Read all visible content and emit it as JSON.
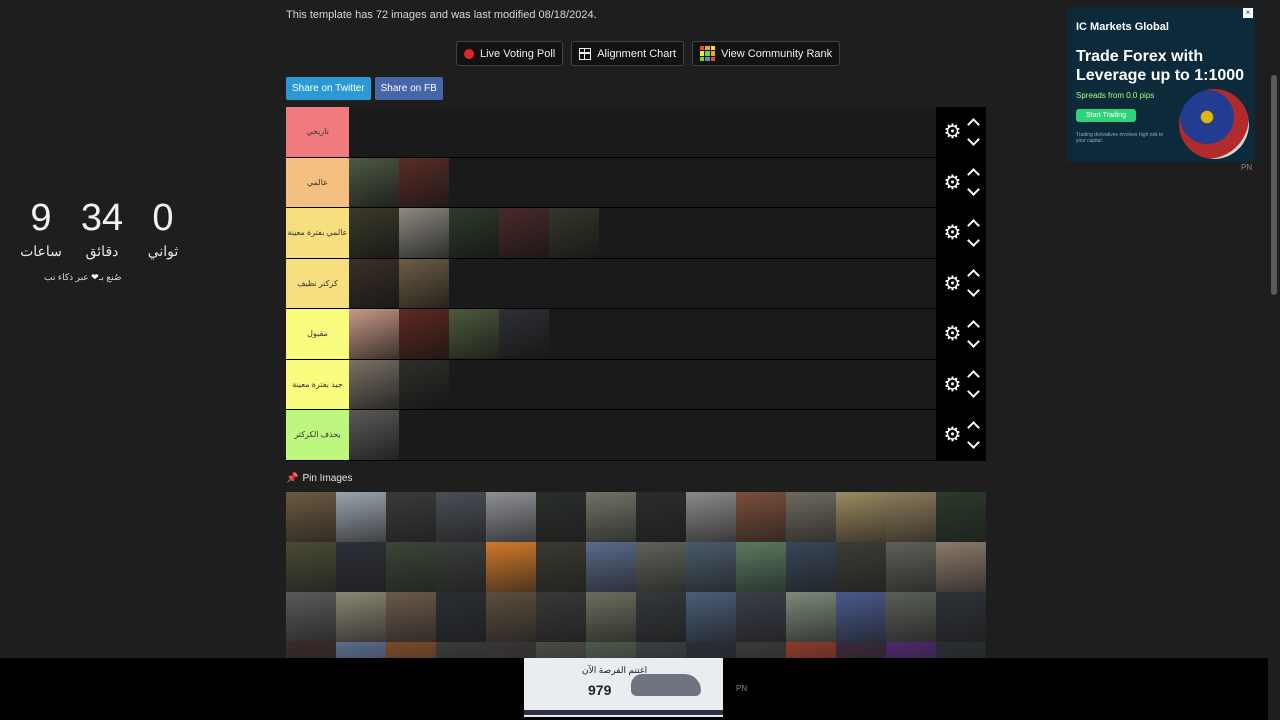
{
  "countdown": {
    "hours": "9",
    "hours_label": "ساعات",
    "minutes": "34",
    "minutes_label": "دقائق",
    "seconds": "0",
    "seconds_label": "ثواني",
    "credit_prefix": "صُنع بـ",
    "credit_heart": "❤",
    "credit_suffix": " عبر ذكاء نب"
  },
  "info_text": "This template has 72 images and was last modified 08/18/2024.",
  "actions": [
    {
      "label": "Live Voting Poll",
      "icon": "red-dot-icon"
    },
    {
      "label": "Alignment Chart",
      "icon": "grid-icon"
    },
    {
      "label": "View Community Rank",
      "icon": "rank-grid-icon"
    }
  ],
  "share": {
    "twitter": "Share on Twitter",
    "facebook": "Share on FB"
  },
  "tiers": [
    {
      "label": "تاريخي",
      "color": "#f07b7f",
      "images": []
    },
    {
      "label": "عالمي",
      "color": "#f5bf7f",
      "images": [
        "#4e5a44",
        "#5a2d28"
      ]
    },
    {
      "label": "عالمي بفترة معينة",
      "color": "#f7df7f",
      "images": [
        "#3b3a2a",
        "#8d8a80",
        "#2e3b2a",
        "#4b2a2a",
        "#34382a"
      ]
    },
    {
      "label": "كركتر نظيف",
      "color": "#f7df7f",
      "images": [
        "#3a3028",
        "#6d5e46"
      ]
    },
    {
      "label": "مقبول",
      "color": "#fafc7f",
      "images": [
        "#c89a86",
        "#5e2a22",
        "#4d5a3e",
        "#2e3034"
      ]
    },
    {
      "label": "جيد بفترة معينة",
      "color": "#fafc7f",
      "images": [
        "#7a7266",
        "#2d2f2a"
      ]
    },
    {
      "label": "يحذف الكركتر",
      "color": "#bdf77f",
      "images": [
        "#5a5a58"
      ]
    }
  ],
  "pin_label": "Pin Images",
  "pool_colors": [
    "#6b5a40",
    "#9aa4ae",
    "#3a3a3a",
    "#4a4e56",
    "#8e9094",
    "#2a2e2a",
    "#6f7466",
    "#2c2c2c",
    "#8a8a8a",
    "#7a4f3a",
    "#6e6a60",
    "#9a8a60",
    "#8a7a5a",
    "#2a3a2a",
    "#4a4a36",
    "#2e3038",
    "#3a4636",
    "#3a3e3a",
    "#d07a2a",
    "#3a3a30",
    "#5a6a8a",
    "#5e6258",
    "#4a5a6a",
    "#5a7a60",
    "#384658",
    "#3c3c36",
    "#5e6058",
    "#8a7a6a",
    "#5a5a58",
    "#8a8674",
    "#6a5a4a",
    "#2a2e34",
    "#5a4e3e",
    "#3a3836",
    "#6a6e5e",
    "#34383c",
    "#4a5e78",
    "#3a3e48",
    "#7a8a7a",
    "#4a5a8a",
    "#5a5e58",
    "#2e3238",
    "#3a2a2a",
    "#5a6a8a",
    "#7a4a2a",
    "#3a3a3a",
    "#3a3638",
    "#4a4a46",
    "#4a5a4a",
    "#3a3e44",
    "#2a2e38",
    "#3a3a3a",
    "#8a3a2a",
    "#3a2a3a",
    "#4a2a6a",
    "#2a2e30"
  ],
  "ad_right": {
    "brand": "IC Markets Global",
    "headline": "Trade Forex with Leverage up to 1:1000",
    "sub": "Spreads from 0.0 pips",
    "cta": "Start Trading",
    "note": "Trading derivatives involves high risk to your capital."
  },
  "ad_bottom": {
    "text": "اغتنم الفرصة الآن",
    "price": "979"
  },
  "pn_right": "PN",
  "pn_bottom": "PN"
}
